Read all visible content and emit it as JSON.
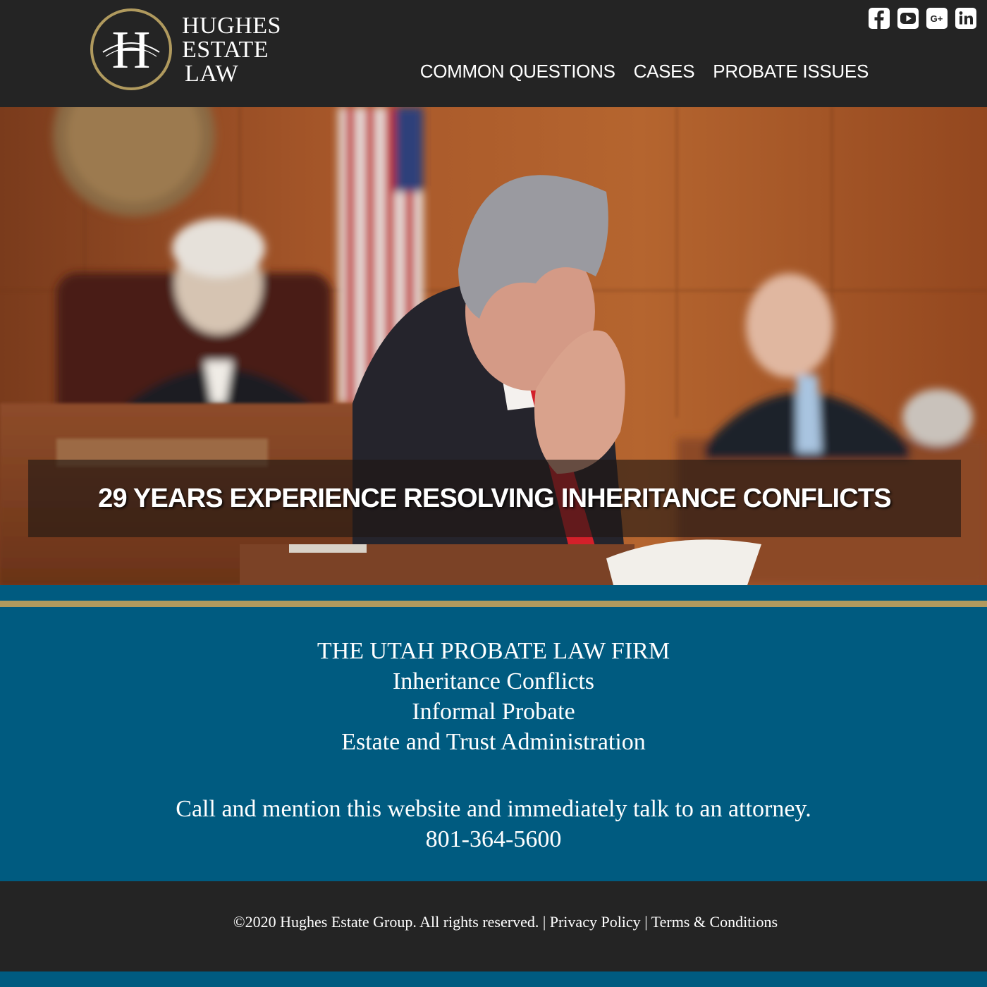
{
  "brand": {
    "logo_line1": "HUGHES",
    "logo_line2": "ESTATE",
    "logo_line3": "LAW",
    "logo_monogram": "H",
    "gold_color": "#b09a5e",
    "blue_color": "#005b80",
    "dark_color": "#242424"
  },
  "social": [
    {
      "icon": "facebook-icon"
    },
    {
      "icon": "youtube-icon"
    },
    {
      "icon": "google-plus-icon"
    },
    {
      "icon": "linkedin-icon"
    }
  ],
  "nav": {
    "items": [
      "COMMON QUESTIONS",
      "CASES",
      "PROBATE ISSUES"
    ]
  },
  "hero": {
    "image": "courtroom-attorney-photo",
    "headline": "29 YEARS EXPERIENCE RESOLVING INHERITANCE CONFLICTS"
  },
  "info": {
    "firm_title": "THE UTAH PROBATE LAW FIRM",
    "services": [
      "Inheritance Conflicts",
      "Informal Probate",
      "Estate and Trust Administration"
    ],
    "call_to_action": "Call and mention this website and immediately talk to an attorney.",
    "phone": "801-364-5600"
  },
  "footer": {
    "copyright": "©2020 Hughes Estate Group. All rights reserved.",
    "separator": "|",
    "privacy_label": "Privacy Policy",
    "terms_label": "Terms & Conditions"
  }
}
